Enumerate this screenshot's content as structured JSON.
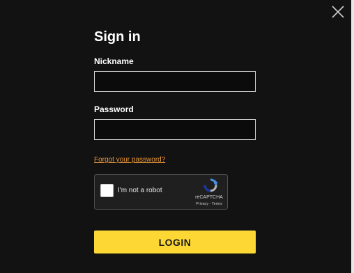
{
  "modal": {
    "title": "Sign in"
  },
  "form": {
    "nickname_label": "Nickname",
    "nickname_value": "",
    "password_label": "Password",
    "password_value": "",
    "forgot_link": "Forgot your password?",
    "login_label": "LOGIN"
  },
  "captcha": {
    "label": "I'm not a robot",
    "brand": "reCAPTCHA",
    "links": "Privacy - Terms",
    "icon": "recaptcha-logo-icon"
  },
  "icons": {
    "close": "close-icon"
  },
  "colors": {
    "background": "#121212",
    "accent_button": "#fdd835",
    "link": "#e8963a",
    "text": "#ffffff"
  }
}
